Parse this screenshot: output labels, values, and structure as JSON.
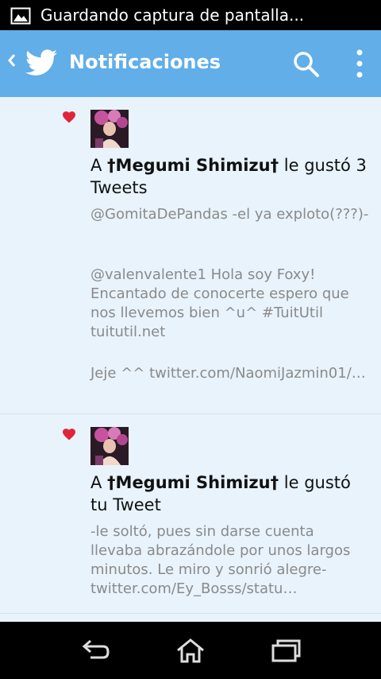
{
  "status_bar": {
    "notification_text": "Guardando captura de pantalla..."
  },
  "app_bar": {
    "title": "Notificaciones",
    "accent": "#61aee8"
  },
  "notifications": [
    {
      "prefix": "A ",
      "user": "†Megumi Shimizu†",
      "action": " le gustó 3 Tweets",
      "tweets": [
        "@GomitaDePandas -el ya exploto(???)-",
        "@valenvalente1 Hola soy Foxy! Encantado de conocerte espero que nos llevemos bien ^u^ #TuitUtil tuitutil.net",
        "Jeje ^^ twitter.com/NaomiJazmin01/…"
      ]
    },
    {
      "prefix": "A ",
      "user": "†Megumi Shimizu†",
      "action": " le gustó tu Tweet",
      "tweets": [
        "-le soltó, pues sin darse cuenta llevaba abrazándole por unos largos minutos. Le miro y sonrió alegre- twitter.com/Ey_Bosss/statu…"
      ]
    }
  ],
  "colors": {
    "heart": "#e0243c",
    "snippet": "#8a8a8a",
    "background": "#e8f3fc"
  }
}
